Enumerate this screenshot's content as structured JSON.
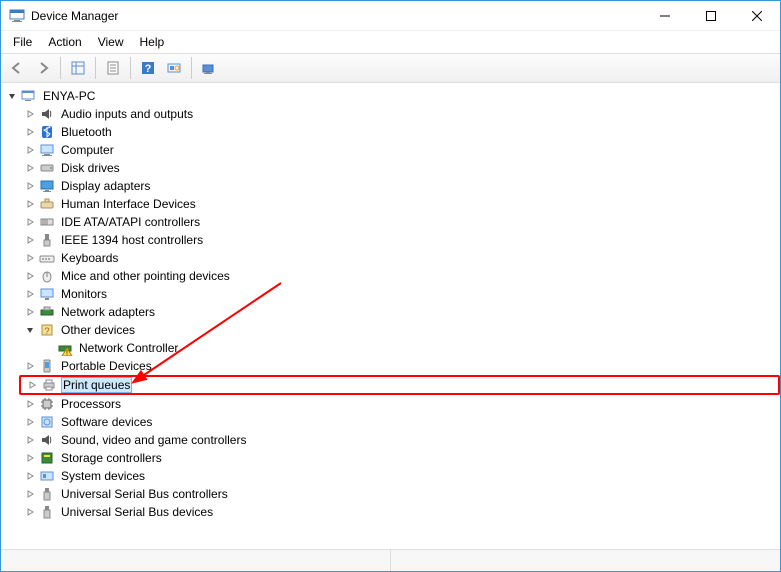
{
  "window": {
    "title": "Device Manager"
  },
  "menu": {
    "file": "File",
    "action": "Action",
    "view": "View",
    "help": "Help"
  },
  "root": {
    "name": "ENYA-PC"
  },
  "cats": {
    "audio": "Audio inputs and outputs",
    "bt": "Bluetooth",
    "computer": "Computer",
    "disk": "Disk drives",
    "display": "Display adapters",
    "hid": "Human Interface Devices",
    "ide": "IDE ATA/ATAPI controllers",
    "ieee": "IEEE 1394 host controllers",
    "keyb": "Keyboards",
    "mice": "Mice and other pointing devices",
    "mon": "Monitors",
    "net": "Network adapters",
    "other": "Other devices",
    "netctrl": "Network Controller",
    "port": "Portable Devices",
    "print": "Print queues",
    "proc": "Processors",
    "soft": "Software devices",
    "sound": "Sound, video and game controllers",
    "stor": "Storage controllers",
    "sys": "System devices",
    "usbc": "Universal Serial Bus controllers",
    "usbd": "Universal Serial Bus devices"
  }
}
